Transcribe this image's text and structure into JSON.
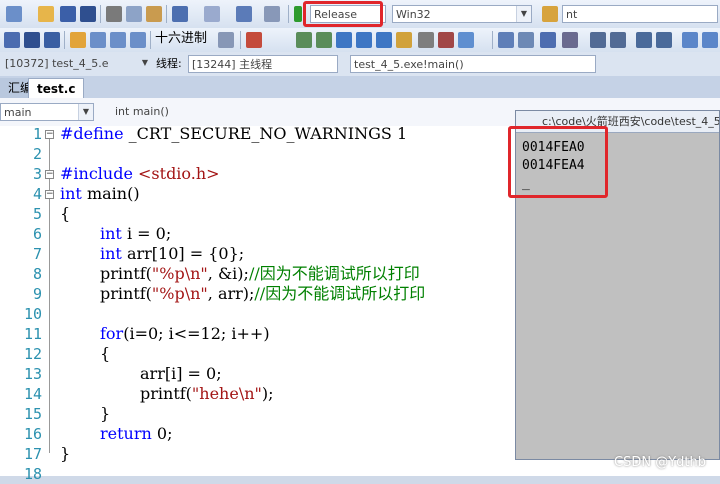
{
  "toolbar1": {
    "config": "Release",
    "platform": "Win32",
    "find": "nt"
  },
  "toolbar2": {
    "hex_label": "十六进制"
  },
  "toolbar3": {
    "process": "[10372] test_4_5.e",
    "thread_label": "线程:",
    "thread": "[13244] 主线程",
    "stack": "test_4_5.exe!main()"
  },
  "tabs": [
    {
      "label": "汇编"
    },
    {
      "label": "test.c"
    }
  ],
  "nav": {
    "scope": "main",
    "function": "int main()"
  },
  "code_lines": [
    {
      "n": "1",
      "t": "#define _CRT_SECURE_NO_WARNINGS 1"
    },
    {
      "n": "2",
      "t": ""
    },
    {
      "n": "3",
      "t": "#include <stdio.h>"
    },
    {
      "n": "4",
      "t": "int main()"
    },
    {
      "n": "5",
      "t": "{"
    },
    {
      "n": "6",
      "t": "int i = 0;"
    },
    {
      "n": "7",
      "t": "int arr[10] = {0};"
    },
    {
      "n": "8",
      "t": "printf(\"%p\\n\", &i);//因为不能调试所以打印"
    },
    {
      "n": "9",
      "t": "printf(\"%p\\n\", arr);//因为不能调试所以打印"
    },
    {
      "n": "10",
      "t": ""
    },
    {
      "n": "11",
      "t": "for(i=0; i<=12; i++)"
    },
    {
      "n": "12",
      "t": "{"
    },
    {
      "n": "13",
      "t": "arr[i] = 0;"
    },
    {
      "n": "14",
      "t": "printf(\"hehe\\n\");"
    },
    {
      "n": "15",
      "t": "}"
    },
    {
      "n": "16",
      "t": "return 0;"
    },
    {
      "n": "17",
      "t": "}"
    },
    {
      "n": "18",
      "t": ""
    }
  ],
  "console": {
    "title": "c:\\code\\火箭班西安\\code\\test_4_5\\",
    "lines": [
      "0014FEA0",
      "0014FEA4",
      "_"
    ]
  },
  "watermark": "CSDN @Ydthb",
  "colors": {
    "highlight": "#e0262b",
    "keyword": "#0000ff",
    "string": "#a31515",
    "comment": "#008000",
    "console_bg": "#c0c0c0"
  }
}
